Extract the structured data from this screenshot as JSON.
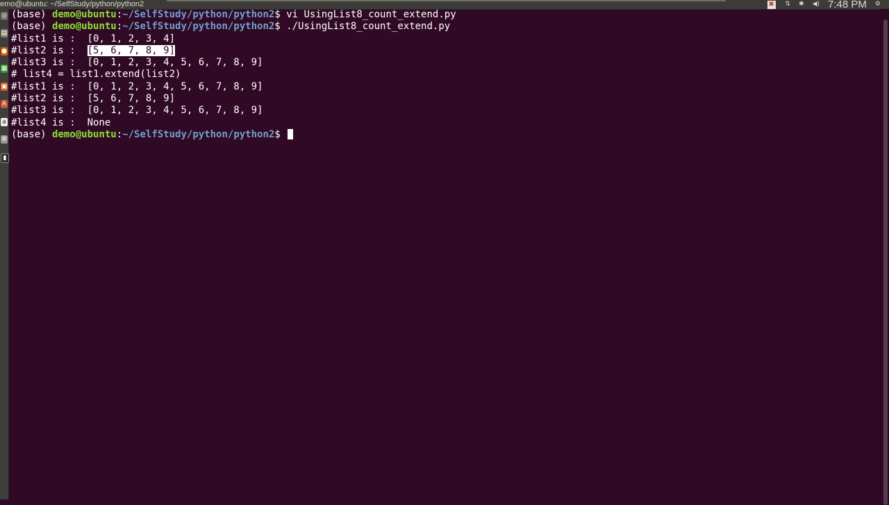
{
  "window": {
    "title": "emo@ubuntu: ~/SelfStudy/python/python2"
  },
  "indicators": {
    "alert": "✖",
    "sort": "⇅",
    "bluetooth": "✱",
    "volume": "◀)",
    "clock": "7:48 PM",
    "settings": "⚙"
  },
  "launcher": {
    "items": [
      "search-icon",
      "files-icon",
      "firefox-icon",
      "libreoffice-calc-icon",
      "libreoffice-impress-icon",
      "software-center-icon",
      "amazon-icon",
      "settings-icon",
      "terminal-icon"
    ]
  },
  "terminal": {
    "prompt": {
      "env": "(base) ",
      "user_host": "demo@ubuntu",
      "sep": ":",
      "path": "~/SelfStudy/python/python2",
      "symbol": "$ "
    },
    "commands": [
      "vi UsingList8_count_extend.py",
      "./UsingList8_count_extend.py",
      ""
    ],
    "output": {
      "l1_label": "#list1 is :  ",
      "l1_value": "[0, 1, 2, 3, 4]",
      "l2_label": "#list2 is :  ",
      "l2_value": "[5, 6, 7, 8, 9]",
      "l3_line": "#list3 is :  [0, 1, 2, 3, 4, 5, 6, 7, 8, 9]",
      "comment": "# list4 = list1.extend(list2)",
      "l1b_line": "#list1 is :  [0, 1, 2, 3, 4, 5, 6, 7, 8, 9]",
      "l2b_line": "#list2 is :  [5, 6, 7, 8, 9]",
      "l3b_line": "#list3 is :  [0, 1, 2, 3, 4, 5, 6, 7, 8, 9]",
      "l4_line": "#list4 is :  None"
    }
  },
  "colors": {
    "background": "#300a24",
    "user": "#8ae234",
    "path": "#729fcf",
    "text": "#ffffff"
  }
}
